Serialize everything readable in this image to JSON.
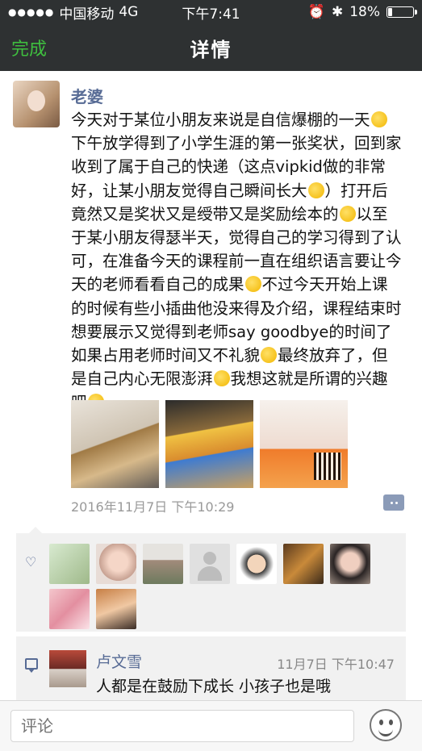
{
  "statusbar": {
    "carrier": "中国移动",
    "network": "4G",
    "time": "下午7:41",
    "battery": "18%",
    "battery_level": 0.18
  },
  "navbar": {
    "back_label": "完成",
    "title": "详情"
  },
  "post": {
    "author": "老婆",
    "text_parts": [
      "今天对于某位小朋友来说是自信爆棚的一天",
      "下午放学得到了小学生涯的第一张奖状，回到家收到了属于自己的快递（这点vipkid做的非常好，让某小朋友觉得自己瞬间长大",
      "）打开后竟然又是奖状又是绶带又是奖励绘本的",
      "以至于某小朋友得瑟半天，觉得自己的学习得到了认可，在准备今天的课程前一直在组织语言要让今天的老师看看自己的成果",
      "不过今天开始上课的时候有些小插曲他没来得及介绍，课程结束时想要展示又觉得到老师say goodbye的时间了如果占用老师时间又不礼貌",
      "最终放弃了，但是自己内心无限澎湃",
      "我想这就是所谓的兴趣吧"
    ],
    "date": "2016年11月7日 下午10:29"
  },
  "comment": {
    "name": "卢文雪",
    "time": "11月7日 下午10:47",
    "text": "人都是在鼓励下成长 小孩子也是哦"
  },
  "bottombar": {
    "input_placeholder": "评论"
  }
}
